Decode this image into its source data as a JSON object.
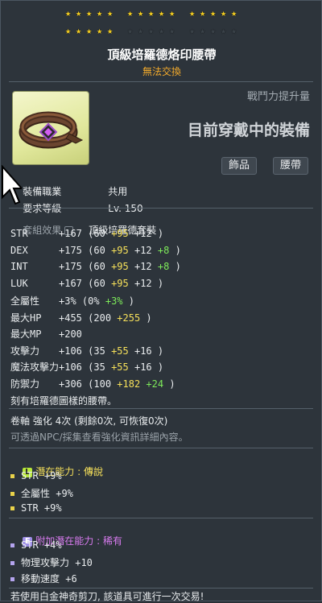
{
  "colors": {
    "gold": "#f3cd22",
    "legend": "#b8e83a",
    "rare": "#d97bf0",
    "bonus_yellow": "#f6e05a",
    "bonus_green": "#7eea5a"
  },
  "stars": {
    "filled": 20,
    "total": 25
  },
  "item": {
    "name": "頂級培羅德烙印腰帶",
    "trade_status": "無法交換",
    "power_label": "戰鬥力提升量",
    "equipped_text": "目前穿戴中的裝備",
    "tags": [
      "飾品",
      "腰帶"
    ],
    "icon": "belt-icon"
  },
  "requirements": [
    {
      "label": "裝備職業",
      "value": "共用"
    },
    {
      "label": "要求等級",
      "value": "Lv. 150"
    }
  ],
  "set_effect": {
    "label": "套組效果",
    "value": "頂級培羅德套裝"
  },
  "stats": [
    {
      "name": "STR",
      "total": "+167",
      "base": "(60",
      "p1": "+95",
      "p2": "+12",
      "p3": "",
      "close": ")"
    },
    {
      "name": "DEX",
      "total": "+175",
      "base": "(60",
      "p1": "+95",
      "p2": "+12",
      "p3": "+8",
      "close": ")"
    },
    {
      "name": "INT",
      "total": "+175",
      "base": "(60",
      "p1": "+95",
      "p2": "+12",
      "p3": "+8",
      "close": ")"
    },
    {
      "name": "LUK",
      "total": "+167",
      "base": "(60",
      "p1": "+95",
      "p2": "+12",
      "p3": "",
      "close": ")"
    },
    {
      "name": "全屬性",
      "total": "+3%",
      "base": "(0%",
      "p1": "",
      "p2": "",
      "p3": "+3%",
      "close": ")"
    },
    {
      "name": "最大HP",
      "total": "+455",
      "base": "(200",
      "p1": "+255",
      "p2": "",
      "p3": "",
      "close": ")"
    },
    {
      "name": "最大MP",
      "total": "+200",
      "base": "",
      "p1": "",
      "p2": "",
      "p3": "",
      "close": ""
    },
    {
      "name": "攻擊力",
      "total": "+106",
      "base": "(35",
      "p1": "+55",
      "p2": "+16",
      "p3": "",
      "close": ")"
    },
    {
      "name": "魔法攻擊力",
      "total": "+106",
      "base": "(35",
      "p1": "+55",
      "p2": "+16",
      "p3": "",
      "close": ")"
    },
    {
      "name": "防禦力",
      "total": "+306",
      "base": "(100",
      "p1": "+182",
      "p2": "",
      "p3": "+24",
      "close": ")"
    }
  ],
  "description": "刻有培羅德圖樣的腰帶。",
  "scroll": "卷軸 強化 4次 (剩餘0次, 可恢復0次)",
  "scroll_hint": "可透過NPC/採集查看強化資訊詳細內容。",
  "potential": {
    "label": "潛在能力",
    "grade": "傳說",
    "lines": [
      "STR +9%",
      "全屬性 +9%",
      "STR +9%"
    ]
  },
  "additional_potential": {
    "label": "附加潛在能力",
    "grade": "稀有",
    "lines": [
      "STR +4%",
      "物理攻擊力 +10",
      "移動速度 +6"
    ]
  },
  "footer_note": "若使用白金神奇剪刀, 該道具可進行一次交易!"
}
